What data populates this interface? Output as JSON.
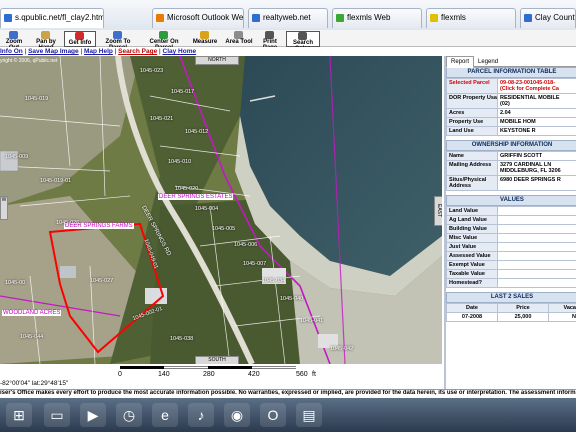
{
  "browser": {
    "tabs": [
      {
        "label": "s.qpublic.net/fl_clay2.html?parcel",
        "icon_color": "#2c6fd1",
        "active": true
      },
      {
        "label": "Microsoft Outlook Web",
        "icon_color": "#e87b00",
        "active": false
      },
      {
        "label": "realtyweb.net",
        "icon_color": "#2c6fd1",
        "active": false
      },
      {
        "label": "flexmls Web",
        "icon_color": "#3aa832",
        "active": false
      },
      {
        "label": "flexmls",
        "icon_color": "#e0c000",
        "active": false
      },
      {
        "label": "Clay County Pr",
        "icon_color": "#2c6fd1",
        "active": false
      }
    ]
  },
  "toolbar": {
    "items": [
      {
        "label": "Zoom Out",
        "icon": "zoom-out-icon",
        "color": "#3f6fc9"
      },
      {
        "label": "Pan by Hand",
        "icon": "hand-icon",
        "color": "#c9a34a"
      },
      {
        "label": "Get Info",
        "icon": "info-icon",
        "color": "#d32b2b"
      },
      {
        "label": "Zoom To Parcel",
        "icon": "zoom-parcel-icon",
        "color": "#3f6fc9"
      },
      {
        "label": "Center On Parcel",
        "icon": "center-icon",
        "color": "#2e9b3e"
      },
      {
        "label": "Measure",
        "icon": "ruler-icon",
        "color": "#d9a21a"
      },
      {
        "label": "Area Tool",
        "icon": "area-icon",
        "color": "#8c8c8c"
      },
      {
        "label": "Print Page",
        "icon": "printer-icon",
        "color": "#555555"
      },
      {
        "label": "Search Sales",
        "icon": "search-sales-icon",
        "color": "#555555"
      }
    ]
  },
  "links": {
    "info": "Info On",
    "save": "Save Map Image",
    "help": "Map Help",
    "search": "Search Page",
    "home": "Clay Home"
  },
  "map": {
    "copyright": "yright © 2006, qPublic.net",
    "north": "NORTH",
    "south": "SOUTH",
    "east": "EAST",
    "west": "W",
    "subdivisions": [
      "DEER SPRINGS ESTATES",
      "DEER SPRINGS FARMS",
      "WOODLAND ACRES"
    ],
    "road": "DEER SPRINGS RD",
    "parcels": [
      "1045-023",
      "1045-017",
      "1045-019",
      "1045-021",
      "1045-012",
      "1045-010",
      "1045-020",
      "1045-024",
      "1045-016",
      "1045-004",
      "1045-005",
      "1045-006",
      "1045-007",
      "1045-005",
      "1045-034",
      "1045-040",
      "1045-041",
      "1045-042",
      "1045-043",
      "1045-008",
      "1045-011",
      "1045-019-01",
      "1045-009",
      "1045-026",
      "1045-049-01",
      "1045-027",
      "1045-002-01",
      "1045-044",
      "1045-038",
      "1045-00"
    ]
  },
  "scale": {
    "ticks": [
      "0",
      "140",
      "280",
      "420",
      "560"
    ],
    "unit": "ft"
  },
  "coords": "-82°00'04\"  lat:29°48'15\"",
  "disclaimer": "iser's Office makes every effort to produce the most accurate information possible. No warranties, expressed or implied, are provided for the data herein, its use or interpretation. The assessment informat",
  "panel": {
    "tabs": [
      "Report",
      "Legend"
    ],
    "parcel_header": "PARCEL INFORMATION TABLE",
    "parcel_rows": [
      {
        "k": "Selected Parcel",
        "v": "09-08-23-001045-018-\n(Click for Complete Ca",
        "red": true
      },
      {
        "k": "DOR Property Usage",
        "v": "RESIDENTIAL MOBILE\n(02)"
      },
      {
        "k": "Acres",
        "v": "2.04"
      },
      {
        "k": "Property Use",
        "v": "MOBILE HOM"
      },
      {
        "k": "Land Use",
        "v": "KEYSTONE R"
      }
    ],
    "owner_header": "OWNERSHIP INFORMATION",
    "owner_rows": [
      {
        "k": "Name",
        "v": "GRIFFIN SCOTT"
      },
      {
        "k": "Mailing Address",
        "v": "3279 CARDINAL LN\nMIDDLEBURG, FL 3206"
      },
      {
        "k": "Situs/Physical Address",
        "v": "6980 DEER SPRINGS R"
      }
    ],
    "values_header": "VALUES",
    "values_rows": [
      "Land Value",
      "Ag Land Value",
      "Building Value",
      "Misc Value",
      "Just Value",
      "Assessed Value",
      "Exempt Value",
      "Taxable Value",
      "Homestead?"
    ],
    "sales_header": "LAST 2 SALES",
    "sales_cols": [
      "Date",
      "Price",
      "Vacant?"
    ],
    "sales_rows": [
      [
        "07-2008",
        "25,000",
        "N"
      ]
    ]
  },
  "taskbar": [
    "start",
    "explorer",
    "media-player",
    "clock",
    "ie",
    "itunes",
    "firefox",
    "opera",
    "window"
  ]
}
